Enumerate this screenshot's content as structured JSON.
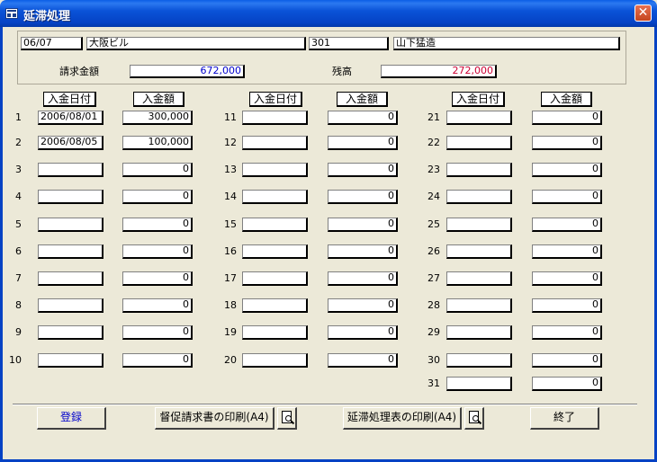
{
  "window": {
    "title": "延滞処理",
    "close_glyph": "✕"
  },
  "header": {
    "date": "06/07",
    "building": "大阪ビル",
    "room": "301",
    "tenant": "山下猛造",
    "billed_label": "請求金額",
    "billed_value": "672,000",
    "balance_label": "残高",
    "balance_value": "272,000",
    "colors": {
      "billed": "#0000cc",
      "balance": "#cc0033"
    }
  },
  "column_headers": {
    "date": "入金日付",
    "amount": "入金額"
  },
  "columns": [
    {
      "rows": [
        {
          "num": "1",
          "date": "2006/08/01",
          "amount": "300,000"
        },
        {
          "num": "2",
          "date": "2006/08/05",
          "amount": "100,000"
        },
        {
          "num": "3",
          "date": "",
          "amount": "0"
        },
        {
          "num": "4",
          "date": "",
          "amount": "0"
        },
        {
          "num": "5",
          "date": "",
          "amount": "0"
        },
        {
          "num": "6",
          "date": "",
          "amount": "0"
        },
        {
          "num": "7",
          "date": "",
          "amount": "0"
        },
        {
          "num": "8",
          "date": "",
          "amount": "0"
        },
        {
          "num": "9",
          "date": "",
          "amount": "0"
        },
        {
          "num": "10",
          "date": "",
          "amount": "0"
        }
      ]
    },
    {
      "rows": [
        {
          "num": "11",
          "date": "",
          "amount": "0"
        },
        {
          "num": "12",
          "date": "",
          "amount": "0"
        },
        {
          "num": "13",
          "date": "",
          "amount": "0"
        },
        {
          "num": "14",
          "date": "",
          "amount": "0"
        },
        {
          "num": "15",
          "date": "",
          "amount": "0"
        },
        {
          "num": "16",
          "date": "",
          "amount": "0"
        },
        {
          "num": "17",
          "date": "",
          "amount": "0"
        },
        {
          "num": "18",
          "date": "",
          "amount": "0"
        },
        {
          "num": "19",
          "date": "",
          "amount": "0"
        },
        {
          "num": "20",
          "date": "",
          "amount": "0"
        }
      ]
    },
    {
      "rows": [
        {
          "num": "21",
          "date": "",
          "amount": "0"
        },
        {
          "num": "22",
          "date": "",
          "amount": "0"
        },
        {
          "num": "23",
          "date": "",
          "amount": "0"
        },
        {
          "num": "24",
          "date": "",
          "amount": "0"
        },
        {
          "num": "25",
          "date": "",
          "amount": "0"
        },
        {
          "num": "26",
          "date": "",
          "amount": "0"
        },
        {
          "num": "27",
          "date": "",
          "amount": "0"
        },
        {
          "num": "28",
          "date": "",
          "amount": "0"
        },
        {
          "num": "29",
          "date": "",
          "amount": "0"
        },
        {
          "num": "30",
          "date": "",
          "amount": "0"
        },
        {
          "num": "31",
          "date": "",
          "amount": "0"
        }
      ]
    }
  ],
  "buttons": {
    "register": "登録",
    "print_reminder": "督促請求書の印刷(A4)",
    "print_overdue": "延滞処理表の印刷(A4)",
    "exit": "終了",
    "register_color": "#0000cc"
  },
  "icons": {
    "preview": "print-preview-icon"
  }
}
